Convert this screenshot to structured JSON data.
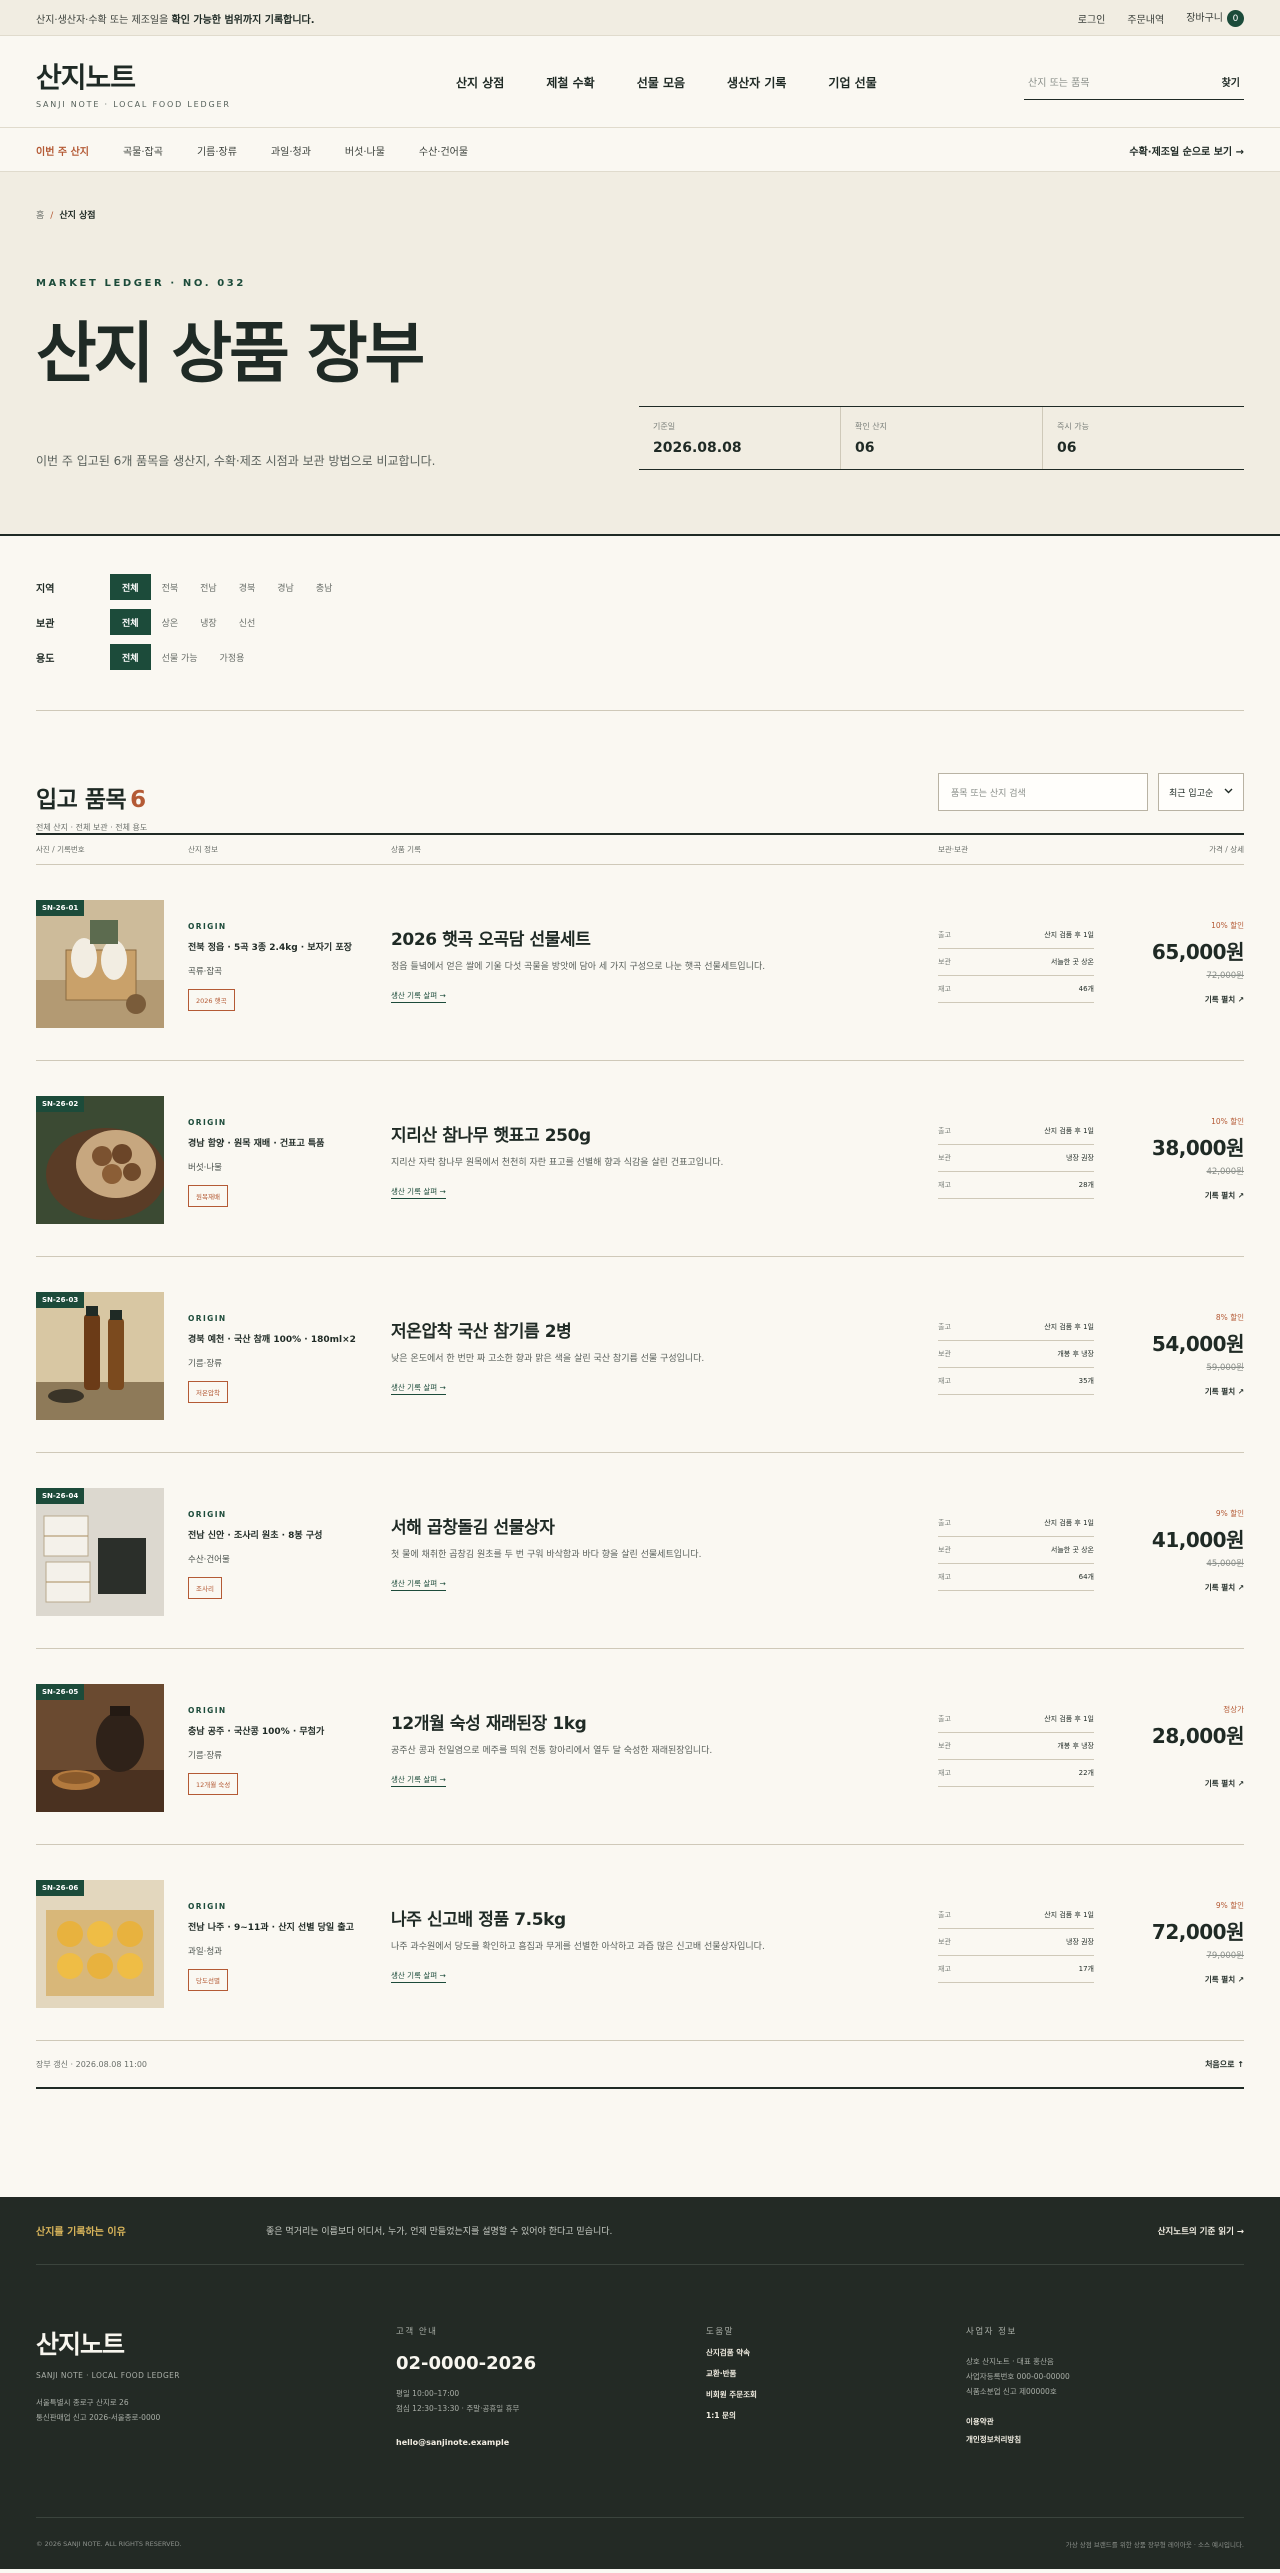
{
  "topbar": {
    "notice_pre": "산지·생산자·수확 또는 제조일을 ",
    "notice_bold": "확인 가능한 범위까지 기록합니다.",
    "login": "로그인",
    "orders": "주문내역",
    "cart": "장바구니",
    "cart_count": "0"
  },
  "header": {
    "logo": "산지노트",
    "logo_sub": "SANJI NOTE · LOCAL FOOD LEDGER",
    "nav": [
      "산지 상점",
      "제철 수확",
      "선물 모음",
      "생산자 기록",
      "기업 선물"
    ],
    "search_placeholder": "산지 또는 품목",
    "search_button": "찾기"
  },
  "catnav": {
    "items": [
      "이번 주 산지",
      "곡물·잡곡",
      "기름·장류",
      "과일·청과",
      "버섯·나물",
      "수산·건어물"
    ],
    "right": "수확·제조일 순으로 보기 →"
  },
  "hero": {
    "breadcrumb_home": "홈",
    "breadcrumb_sep": "/",
    "breadcrumb_current": "산지 상점",
    "eyebrow": "MARKET LEDGER · NO. 032",
    "title": "산지 상품 장부",
    "desc": "이번 주 입고된 6개 품목을 생산지, 수확·제조 시점과 보관 방법으로 비교합니다.",
    "stats": [
      {
        "label": "기준일",
        "value": "2026.08.08"
      },
      {
        "label": "확인 산지",
        "value": "06"
      },
      {
        "label": "즉시 가능",
        "value": "06"
      }
    ]
  },
  "filters": [
    {
      "label": "지역",
      "options": [
        "전체",
        "전북",
        "전남",
        "경북",
        "경남",
        "충남"
      ]
    },
    {
      "label": "보관",
      "options": [
        "전체",
        "상온",
        "냉장",
        "신선"
      ]
    },
    {
      "label": "용도",
      "options": [
        "전체",
        "선물 가능",
        "가정용"
      ]
    }
  ],
  "list": {
    "title": "입고 품목",
    "count": "6",
    "sub": "전체 산지 · 전체 보관 · 전체 용도",
    "search_placeholder": "품목 또는 산지 검색",
    "sort": "최근 입고순",
    "columns": [
      "사진 / 기록번호",
      "산지 정보",
      "상품 기록",
      "보관·보관",
      "가격 / 상세"
    ],
    "footer_left": "장부 갱신 · 2026.08.08 11:00",
    "footer_right": "처음으로 ↑"
  },
  "products": [
    {
      "code": "SN-26-01",
      "origin_label": "ORIGIN",
      "place": "전북 정읍 · 5곡 3종 2.4kg · 보자기 포장",
      "category": "곡류·잡곡",
      "tag": "2026 햇곡",
      "title": "2026 햇곡 오곡담 선물세트",
      "text": "정읍 들녘에서 얻은 쌀에 기울 다섯 곡물을 방앗에 담아 세 가지 구성으로 나눈 햇곡 선물세트입니다.",
      "more": "생산 기록 살펴 →",
      "spec": [
        {
          "k": "출고",
          "v": "산지 검품 후 1일"
        },
        {
          "k": "보관",
          "v": "서늘한 곳 상온"
        },
        {
          "k": "재고",
          "v": "46개"
        }
      ],
      "discount": "10% 할인",
      "price": "65,000원",
      "was": "72,000원",
      "record": "기록 펼치 ↗"
    },
    {
      "code": "SN-26-02",
      "origin_label": "ORIGIN",
      "place": "경남 함양 · 원목 재배 · 건표고 특품",
      "category": "버섯·나물",
      "tag": "원목재배",
      "title": "지리산 참나무 햇표고 250g",
      "text": "지리산 자락 참나무 원목에서 천천히 자란 표고를 선별해 향과 식감을 살린 건표고입니다.",
      "more": "생산 기록 살펴 →",
      "spec": [
        {
          "k": "출고",
          "v": "산지 검품 후 1일"
        },
        {
          "k": "보관",
          "v": "냉장 권장"
        },
        {
          "k": "재고",
          "v": "28개"
        }
      ],
      "discount": "10% 할인",
      "price": "38,000원",
      "was": "42,000원",
      "record": "기록 펼치 ↗"
    },
    {
      "code": "SN-26-03",
      "origin_label": "ORIGIN",
      "place": "경북 예천 · 국산 참깨 100% · 180ml×2",
      "category": "기름·장류",
      "tag": "저온압착",
      "title": "저온압착 국산 참기름 2병",
      "text": "낮은 온도에서 한 번만 짜 고소한 향과 맑은 색을 살린 국산 참기름 선물 구성입니다.",
      "more": "생산 기록 살펴 →",
      "spec": [
        {
          "k": "출고",
          "v": "산지 검품 후 1일"
        },
        {
          "k": "보관",
          "v": "개봉 후 냉장"
        },
        {
          "k": "재고",
          "v": "35개"
        }
      ],
      "discount": "8% 할인",
      "price": "54,000원",
      "was": "59,000원",
      "record": "기록 펼치 ↗"
    },
    {
      "code": "SN-26-04",
      "origin_label": "ORIGIN",
      "place": "전남 신안 · 조사리 원초 · 8봉 구성",
      "category": "수산·건어물",
      "tag": "조사리",
      "title": "서해 곱창돌김 선물상자",
      "text": "첫 물에 채취한 곱창김 원초를 두 번 구워 바삭함과 바다 향을 살린 선물세트입니다.",
      "more": "생산 기록 살펴 →",
      "spec": [
        {
          "k": "출고",
          "v": "산지 검품 후 1일"
        },
        {
          "k": "보관",
          "v": "서늘한 곳 상온"
        },
        {
          "k": "재고",
          "v": "64개"
        }
      ],
      "discount": "9% 할인",
      "price": "41,000원",
      "was": "45,000원",
      "record": "기록 펼치 ↗"
    },
    {
      "code": "SN-26-05",
      "origin_label": "ORIGIN",
      "place": "충남 공주 · 국산콩 100% · 무첨가",
      "category": "기름·장류",
      "tag": "12개월 숙성",
      "title": "12개월 숙성 재래된장 1kg",
      "text": "공주산 콩과 천일염으로 메주를 띄워 전통 항아리에서 열두 달 숙성한 재래된장입니다.",
      "more": "생산 기록 살펴 →",
      "spec": [
        {
          "k": "출고",
          "v": "산지 검품 후 1일"
        },
        {
          "k": "보관",
          "v": "개봉 후 냉장"
        },
        {
          "k": "재고",
          "v": "22개"
        }
      ],
      "discount": "정상가",
      "price": "28,000원",
      "was": "",
      "record": "기록 펼치 ↗"
    },
    {
      "code": "SN-26-06",
      "origin_label": "ORIGIN",
      "place": "전남 나주 · 9~11과 · 산지 선별 당일 출고",
      "category": "과일·청과",
      "tag": "당도선별",
      "title": "나주 신고배 정품 7.5kg",
      "text": "나주 과수원에서 당도를 확인하고 흠집과 무게를 선별한 아삭하고 과즙 많은 신고배 선물상자입니다.",
      "more": "생산 기록 살펴 →",
      "spec": [
        {
          "k": "출고",
          "v": "산지 검품 후 1일"
        },
        {
          "k": "보관",
          "v": "냉장 권장"
        },
        {
          "k": "재고",
          "v": "17개"
        }
      ],
      "discount": "9% 할인",
      "price": "72,000원",
      "was": "79,000원",
      "record": "기록 펼치 ↗"
    }
  ],
  "footer": {
    "why_title": "산지를 기록하는 이유",
    "why_text": "좋은 먹거리는 이름보다 어디서, 누가, 언제 만들었는지를 설명할 수 있어야 한다고 믿습니다.",
    "why_link": "산지노트의 기준 읽기 →",
    "logo": "산지노트",
    "logo_sub": "SANJI NOTE · LOCAL FOOD LEDGER",
    "address1": "서울특별시 종로구 산지로 26",
    "address2": "통신판매업 신고 2026-서울종로-0000",
    "cs_title": "고객 안내",
    "tel": "02-0000-2026",
    "hours1": "평일 10:00–17:00",
    "hours2": "점심 12:30–13:30 · 주말·공휴일 휴무",
    "email": "hello@sanjinote.example",
    "help_title": "도움말",
    "help_links": [
      "산지검품 약속",
      "교환·반품",
      "비회원 주문조회",
      "1:1 문의"
    ],
    "biz_title": "사업자 정보",
    "biz1": "상호 산지노트 · 대표 홍산음",
    "biz2": "사업자등록번호 000-00-00000",
    "biz3": "식품소분업 신고 제00000호",
    "terms": "이용약관",
    "privacy": "개인정보처리방침",
    "copyright": "© 2026 SANJI NOTE. ALL RIGHTS RESERVED.",
    "bottom_right": "가상 상점 브랜드를 위한 상품 장부형 레이아웃 · 소스 예시입니다."
  }
}
